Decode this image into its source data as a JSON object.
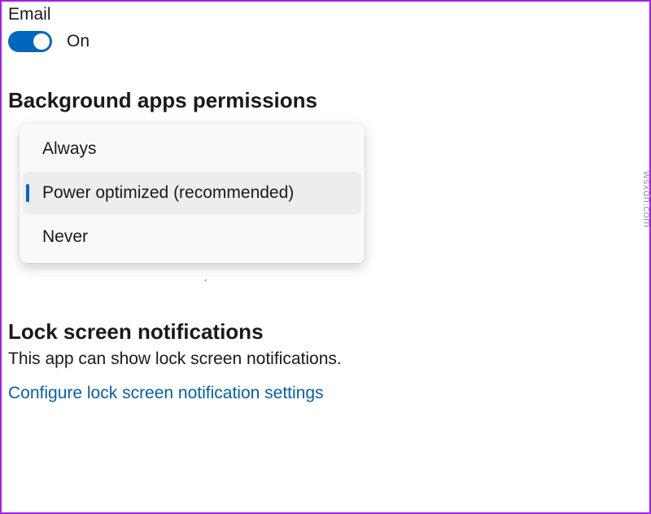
{
  "email": {
    "label": "Email",
    "toggle_state": "On"
  },
  "background_apps": {
    "heading": "Background apps permissions",
    "options": {
      "always": "Always",
      "power_optimized": "Power optimized (recommended)",
      "never": "Never"
    },
    "behind_fragment": "."
  },
  "lock_screen": {
    "heading": "Lock screen notifications",
    "description": "This app can show lock screen notifications.",
    "link": "Configure lock screen notification settings"
  },
  "watermark": "wsxdn.com"
}
